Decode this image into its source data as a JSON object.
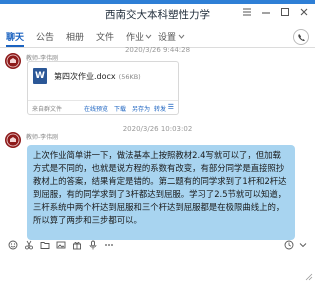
{
  "window": {
    "title": "西南交大本科塑性力学"
  },
  "tabs": [
    {
      "label": "聊天",
      "active": true
    },
    {
      "label": "公告"
    },
    {
      "label": "相册"
    },
    {
      "label": "文件"
    },
    {
      "label": "作业"
    },
    {
      "label": "设置"
    }
  ],
  "messages": {
    "first": {
      "timestamp": "2020/3/26 9:44:28",
      "sender": "教师-李伟刚",
      "file": {
        "icon_letter": "W",
        "name": "第四次作业.docx",
        "size": "(56KB)",
        "source": "来自群文件",
        "actions": [
          "在线预览",
          "下载",
          "另存为",
          "转发"
        ]
      }
    },
    "second": {
      "timestamp": "2020/3/26 10:03:02",
      "sender": "教师-李伟刚",
      "text": "上次作业简单讲一下，做法基本上按照教材2.4写就可以了，但加载方式是不同的，也就是说方程的系数有改变，有部分同学是直接照抄教材上的答案，结果肯定是错的。第二题有的同学求到了1杆和2杆达到屈服，有的同学求到了3杆都达到屈服。学习了2.5节就可以知道，三杆系统中两个杆达到屈服和三个杆达到屈服都是在极限曲线上的，所以算了两步和三步都可以。"
    }
  },
  "colors": {
    "accent": "#1a62c0",
    "bubble": "#a8d4f0",
    "title_strip": "#2e7fd6"
  }
}
